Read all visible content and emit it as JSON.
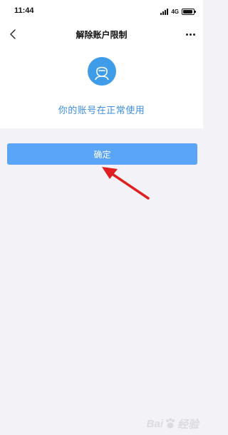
{
  "status_bar": {
    "time": "11:44",
    "network": "4G",
    "battery_level": 0.9
  },
  "nav": {
    "title": "解除账户限制",
    "back_icon": "chevron-left-icon",
    "more_icon": "more-horizontal-icon"
  },
  "info": {
    "avatar_icon": "user-icon",
    "message": "你的账号在正常使用",
    "accent_color": "#3f9ce8"
  },
  "actions": {
    "confirm_label": "确定",
    "button_color": "#5aa5f7"
  },
  "annotation": {
    "arrow_color": "#e02020"
  },
  "watermark": {
    "brand": "Bai",
    "suffix": "经验"
  }
}
